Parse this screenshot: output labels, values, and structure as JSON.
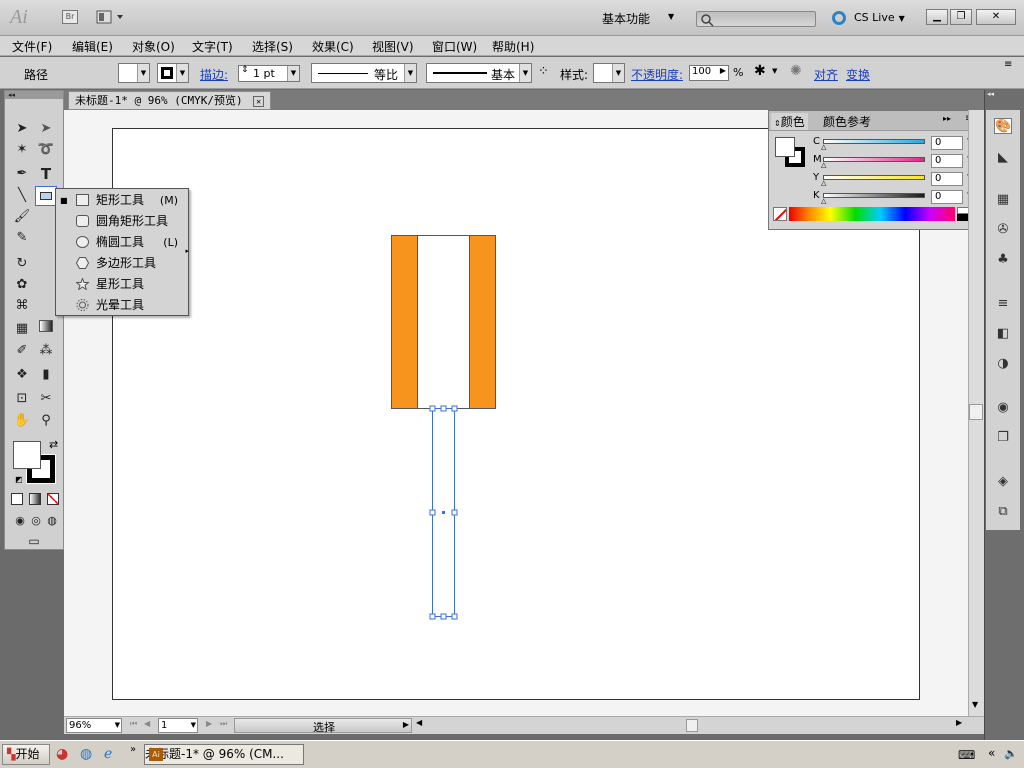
{
  "titlebar": {
    "app_logo": "Ai",
    "bridge_label": "Br",
    "workspace": "基本功能",
    "cslive": "CS Live"
  },
  "menu": [
    "文件(F)",
    "编辑(E)",
    "对象(O)",
    "文字(T)",
    "选择(S)",
    "效果(C)",
    "视图(V)",
    "窗口(W)",
    "帮助(H)"
  ],
  "control": {
    "object_type": "路径",
    "stroke_label": "描边:",
    "stroke_weight": "1 pt",
    "profile_uniform": "等比",
    "brush_basic": "基本",
    "style_label": "样式:",
    "opacity_label": "不透明度:",
    "opacity_value": "100",
    "opacity_unit": "%",
    "align_label": "对齐",
    "transform_label": "变换"
  },
  "document_tab": "未标题-1* @ 96% (CMYK/预览)",
  "flyout": [
    {
      "label": "矩形工具",
      "shortcut": "(M)",
      "icon": "rectangle-icon",
      "selected": true
    },
    {
      "label": "圆角矩形工具",
      "shortcut": "",
      "icon": "rounded-rectangle-icon",
      "selected": false
    },
    {
      "label": "椭圆工具",
      "shortcut": "(L)",
      "icon": "ellipse-icon",
      "selected": false
    },
    {
      "label": "多边形工具",
      "shortcut": "",
      "icon": "polygon-icon",
      "selected": false
    },
    {
      "label": "星形工具",
      "shortcut": "",
      "icon": "star-icon",
      "selected": false
    },
    {
      "label": "光晕工具",
      "shortcut": "",
      "icon": "flare-icon",
      "selected": false
    }
  ],
  "color_panel": {
    "tab_color": "颜色",
    "tab_guide": "颜色参考",
    "channels": [
      {
        "name": "C",
        "value": "0",
        "unit": "%",
        "color": "#26a9e0"
      },
      {
        "name": "M",
        "value": "0",
        "unit": "%",
        "color": "#e0268a"
      },
      {
        "name": "Y",
        "value": "0",
        "unit": "%",
        "color": "#f5e626"
      },
      {
        "name": "K",
        "value": "0",
        "unit": "%",
        "color": "#1a1a1a"
      }
    ]
  },
  "artwork": {
    "fill_orange": "#f7941e",
    "selection_blue": "#3b6fd6"
  },
  "status": {
    "zoom": "96%",
    "artboard": "1",
    "status_text": "选择"
  },
  "taskbar": {
    "start": "开始",
    "task": "未标题-1* @ 96% (CM..."
  }
}
